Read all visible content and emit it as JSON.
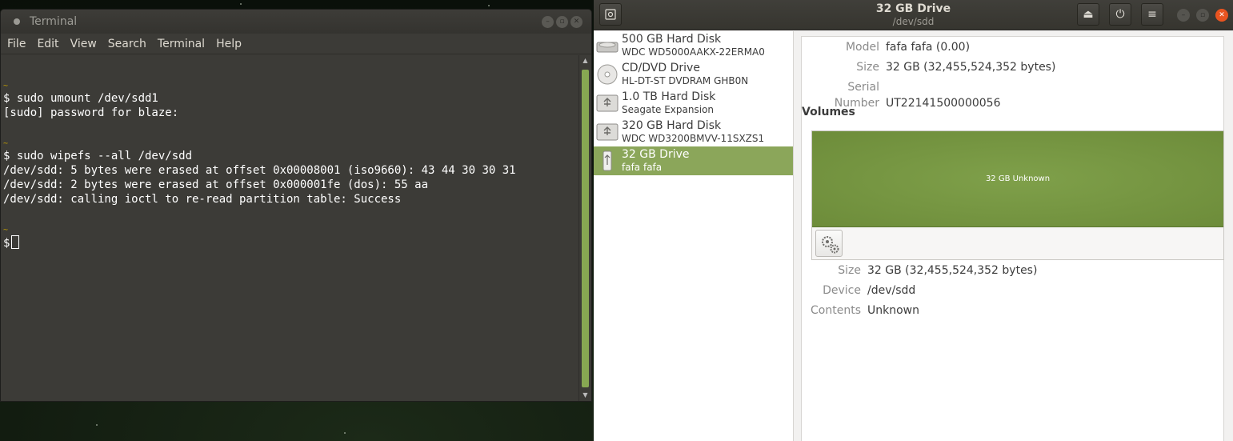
{
  "terminal": {
    "title": "Terminal",
    "menu": [
      "File",
      "Edit",
      "View",
      "Search",
      "Terminal",
      "Help"
    ],
    "lines": [
      {
        "kind": "tilde",
        "text": "~"
      },
      {
        "kind": "text",
        "text": "$ sudo umount /dev/sdd1"
      },
      {
        "kind": "text",
        "text": "[sudo] password for blaze:"
      },
      {
        "kind": "blank",
        "text": ""
      },
      {
        "kind": "tilde",
        "text": "~"
      },
      {
        "kind": "text",
        "text": "$ sudo wipefs --all /dev/sdd"
      },
      {
        "kind": "text",
        "text": "/dev/sdd: 5 bytes were erased at offset 0x00008001 (iso9660): 43 44 30 30 31"
      },
      {
        "kind": "text",
        "text": "/dev/sdd: 2 bytes were erased at offset 0x000001fe (dos): 55 aa"
      },
      {
        "kind": "text",
        "text": "/dev/sdd: calling ioctl to re-read partition table: Success"
      },
      {
        "kind": "blank",
        "text": ""
      },
      {
        "kind": "tilde",
        "text": "~"
      }
    ],
    "prompt": "$"
  },
  "disks": {
    "title": "32 GB Drive",
    "subtitle": "/dev/sdd",
    "drives": [
      {
        "name": "500 GB Hard Disk",
        "desc": "WDC WD5000AAKX-22ERMA0",
        "icon": "hard-disk-icon",
        "selected": false
      },
      {
        "name": "CD/DVD Drive",
        "desc": "HL-DT-ST DVDRAM GHB0N",
        "icon": "optical-drive-icon",
        "selected": false
      },
      {
        "name": "1.0 TB Hard Disk",
        "desc": "Seagate Expansion",
        "icon": "usb-disk-icon",
        "selected": false
      },
      {
        "name": "320 GB Hard Disk",
        "desc": "WDC WD3200BMVV-11SXZS1",
        "icon": "usb-disk-icon",
        "selected": false
      },
      {
        "name": "32 GB Drive",
        "desc": "fafa fafa",
        "icon": "usb-stick-icon",
        "selected": true
      }
    ],
    "details": [
      {
        "key": "Model",
        "value": "fafa fafa (0.00)"
      },
      {
        "key": "Size",
        "value": "32 GB (32,455,524,352 bytes)"
      },
      {
        "key": "Serial Number",
        "value": "UT22141500000056"
      }
    ],
    "volumes_heading": "Volumes",
    "volume_label": "32 GB Unknown",
    "volume_details": [
      {
        "key": "Size",
        "value": "32 GB (32,455,524,352 bytes)"
      },
      {
        "key": "Device",
        "value": "/dev/sdd"
      },
      {
        "key": "Contents",
        "value": "Unknown"
      }
    ],
    "accent_color": "#8ba65a"
  }
}
